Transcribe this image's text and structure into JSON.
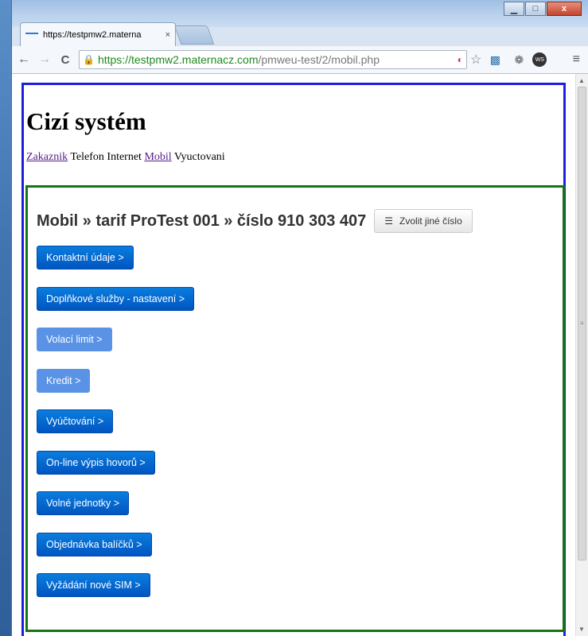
{
  "browser": {
    "tab_title": "https://testpmw2.materna",
    "tab_close": "×",
    "url_secure": "https://",
    "url_host": "testpmw2.maternacz.com",
    "url_path": "/pmweu-test/2/mobil.php",
    "nav": {
      "back": "←",
      "forward": "→",
      "reload": "C"
    },
    "window_controls": {
      "minimize": "▁",
      "maximize": "□",
      "close": "x"
    },
    "menu": "≡",
    "extensions": {
      "ws_label": "WS"
    }
  },
  "page": {
    "title": "Cizí systém",
    "menu": [
      {
        "label": "Zakaznik",
        "link": true
      },
      {
        "label": "Telefon",
        "link": false
      },
      {
        "label": "Internet",
        "link": false
      },
      {
        "label": "Mobil",
        "link": true
      },
      {
        "label": "Vyuctovani",
        "link": false
      }
    ],
    "heading": "Mobil » tarif ProTest 001 » číslo 910 303 407",
    "change_number_label": "Zvolit jiné číslo",
    "buttons": [
      {
        "label": "Kontaktní údaje >",
        "disabled": false
      },
      {
        "label": "Doplňkové služby - nastavení >",
        "disabled": false
      },
      {
        "label": "Volací limit >",
        "disabled": true
      },
      {
        "label": "Kredit >",
        "disabled": true
      },
      {
        "label": "Vyúčtování >",
        "disabled": false
      },
      {
        "label": "On-line výpis hovorů >",
        "disabled": false
      },
      {
        "label": "Volné jednotky >",
        "disabled": false
      },
      {
        "label": "Objednávka balíčků >",
        "disabled": false
      },
      {
        "label": "Vyžádání nové SIM >",
        "disabled": false
      }
    ]
  },
  "colors": {
    "outer_border": "#1f1fe0",
    "inner_border": "#157515",
    "button_primary": "#0062cc",
    "button_disabled": "#5a93e6"
  }
}
